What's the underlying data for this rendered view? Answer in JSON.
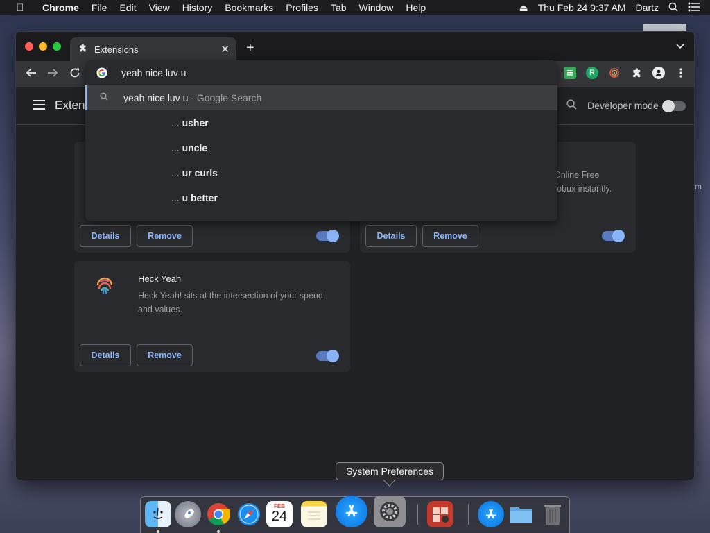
{
  "menubar": {
    "items": [
      "Chrome",
      "File",
      "Edit",
      "View",
      "History",
      "Bookmarks",
      "Profiles",
      "Tab",
      "Window",
      "Help"
    ],
    "datetime": "Thu Feb 24  9:37 AM",
    "user": "Dartz"
  },
  "desktop": {
    "peek_text": "m"
  },
  "browser": {
    "tab_title": "Extensions",
    "omnibox": {
      "query": "yeah nice luv u",
      "suggestions": [
        {
          "text": "yeah nice luv u",
          "suffix": "- Google Search"
        },
        {
          "prefix": "...",
          "text": "usher"
        },
        {
          "prefix": "...",
          "text": "uncle"
        },
        {
          "prefix": "...",
          "text": "ur curls"
        },
        {
          "prefix": "...",
          "text": "u better"
        }
      ]
    }
  },
  "extensions_page": {
    "title": "Extens",
    "developer_mode_label": "Developer mode",
    "developer_mode": false,
    "cards": [
      {
        "name": "",
        "description": "",
        "details_label": "Details",
        "remove_label": "Remove",
        "enabled": true
      },
      {
        "name": "",
        "description_partial_1": "Online Free",
        "description_partial_2": "robux instantly.",
        "details_label": "Details",
        "remove_label": "Remove",
        "enabled": true
      },
      {
        "name": "Heck Yeah",
        "description": "Heck Yeah! sits at the intersection of your spend and values.",
        "details_label": "Details",
        "remove_label": "Remove",
        "enabled": true
      }
    ]
  },
  "dock": {
    "tooltip": "System Preferences",
    "calendar_month": "FEB",
    "calendar_day": "24"
  },
  "colors": {
    "accent": "#8ab4f8",
    "page_bg": "#202124",
    "card_bg": "#292a2d"
  }
}
